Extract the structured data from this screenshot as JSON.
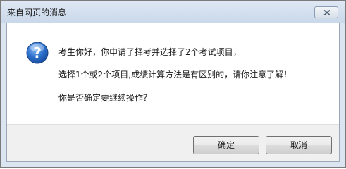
{
  "window": {
    "title": "来自网页的消息"
  },
  "icon": "question-icon",
  "message": {
    "line1": "考生你好，你申请了择考并选择了2个考试项目，",
    "line2": "选择1个或2个项目,成绩计算方法是有区别的，请你注意了解！",
    "line3": "你是否确定要继续操作？"
  },
  "buttons": {
    "ok_label": "确定",
    "cancel_label": "取消"
  }
}
